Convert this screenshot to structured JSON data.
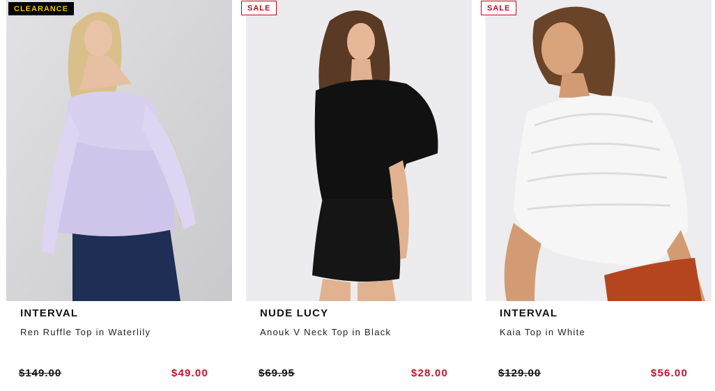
{
  "products": [
    {
      "badge": "CLEARANCE",
      "badge_icon": "clearance-badge",
      "brand": "INTERVAL",
      "name": "Ren Ruffle Top in Waterlily",
      "was_price": "$149.00",
      "now_price": "$49.00",
      "image": "model wearing lilac off-shoulder ruffle top and navy jeans"
    },
    {
      "badge": "SALE",
      "badge_icon": "sale-badge",
      "brand": "NUDE LUCY",
      "name": "Anouk V Neck Top in Black",
      "was_price": "$69.95",
      "now_price": "$28.00",
      "image": "model wearing black wrap v-neck top and black shorts"
    },
    {
      "badge": "SALE",
      "badge_icon": "sale-badge",
      "brand": "INTERVAL",
      "name": "Kaia Top in White",
      "was_price": "$129.00",
      "now_price": "$56.00",
      "image": "model wearing white shirred crop top and rust pants"
    }
  ],
  "colors": {
    "sale_red": "#c8102e",
    "clearance_yellow": "#f2c200",
    "text_dark": "#111111"
  }
}
